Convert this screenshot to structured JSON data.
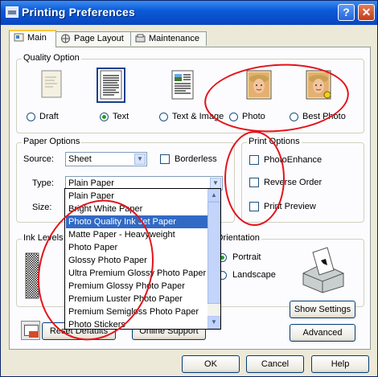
{
  "window": {
    "title": "Printing Preferences",
    "help_glyph": "?",
    "close_glyph": "✕"
  },
  "tabs": [
    {
      "label": "Main",
      "active": true
    },
    {
      "label": "Page Layout",
      "active": false
    },
    {
      "label": "Maintenance",
      "active": false
    }
  ],
  "quality": {
    "label": "Quality Option",
    "options": [
      {
        "label": "Draft",
        "selected": false
      },
      {
        "label": "Text",
        "selected": true
      },
      {
        "label": "Text & Image",
        "selected": false
      },
      {
        "label": "Photo",
        "selected": false
      },
      {
        "label": "Best Photo",
        "selected": false
      }
    ]
  },
  "paper": {
    "label": "Paper Options",
    "source_label": "Source:",
    "source_value": "Sheet",
    "borderless_label": "Borderless",
    "type_label": "Type:",
    "type_value": "Plain Paper",
    "size_label": "Size:",
    "type_options": [
      "Plain Paper",
      "Bright White Paper",
      "Photo Quality Ink Jet Paper",
      "Matte Paper - Heavyweight",
      "Photo Paper",
      "Glossy Photo Paper",
      "Ultra Premium Glossy Photo Paper",
      "Premium Glossy Photo Paper",
      "Premium Luster Photo Paper",
      "Premium Semigloss Photo Paper",
      "Photo Stickers"
    ],
    "highlighted": "Photo Quality Ink Jet Paper"
  },
  "print_options": {
    "label": "Print Options",
    "items": [
      "PhotoEnhance",
      "Reverse Order",
      "Print Preview"
    ]
  },
  "ink": {
    "label": "Ink Levels"
  },
  "orientation": {
    "label": "Orientation",
    "portrait": "Portrait",
    "landscape": "Landscape",
    "selected": "Portrait"
  },
  "buttons": {
    "show_settings": "Show Settings",
    "advanced": "Advanced",
    "reset_defaults": "Reset Defaults",
    "online_support": "Online Support",
    "ok": "OK",
    "cancel": "Cancel",
    "help": "Help"
  },
  "colors": {
    "annotation": "#e5121a",
    "highlight": "#316ac5",
    "title_bar": "#0a5ad8"
  }
}
